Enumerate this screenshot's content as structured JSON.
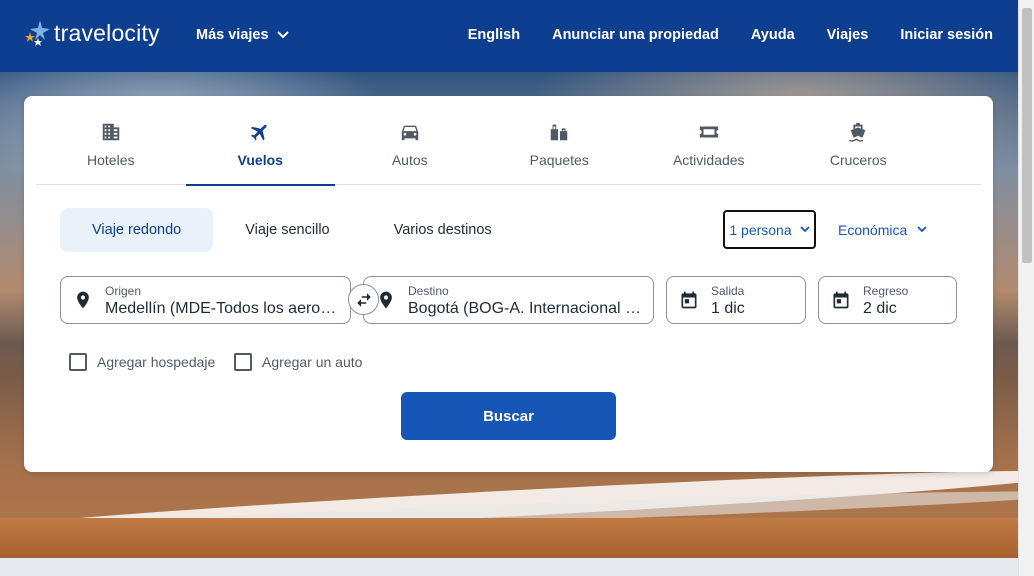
{
  "brand": {
    "name": "travelocity"
  },
  "nav": {
    "more_trips": "Más viajes",
    "links": [
      "English",
      "Anunciar una propiedad",
      "Ayuda",
      "Viajes",
      "Iniciar sesión"
    ]
  },
  "tabs": [
    {
      "label": "Hoteles",
      "icon": "building-icon",
      "active": false
    },
    {
      "label": "Vuelos",
      "icon": "plane-icon",
      "active": true
    },
    {
      "label": "Autos",
      "icon": "car-icon",
      "active": false
    },
    {
      "label": "Paquetes",
      "icon": "luggage-icon",
      "active": false
    },
    {
      "label": "Actividades",
      "icon": "ticket-icon",
      "active": false
    },
    {
      "label": "Cruceros",
      "icon": "ship-icon",
      "active": false
    }
  ],
  "trip_types": [
    {
      "label": "Viaje redondo",
      "active": true
    },
    {
      "label": "Viaje sencillo",
      "active": false
    },
    {
      "label": "Varios destinos",
      "active": false
    }
  ],
  "travellers": "1 persona",
  "cabin": "Económica",
  "fields": {
    "origin": {
      "label": "Origen",
      "value": "Medellín (MDE-Todos los aeropuertos)"
    },
    "destination": {
      "label": "Destino",
      "value": "Bogotá (BOG-A. Internacional El Dorado)"
    },
    "departure": {
      "label": "Salida",
      "value": "1 dic"
    },
    "return": {
      "label": "Regreso",
      "value": "2 dic"
    }
  },
  "options": {
    "add_hotel": "Agregar hospedaje",
    "add_car": "Agregar un auto"
  },
  "search_button": "Buscar",
  "colors": {
    "nav_bg": "#0e3e8f",
    "accent": "#1556b6",
    "active_trip_bg": "#e9f1fb"
  }
}
